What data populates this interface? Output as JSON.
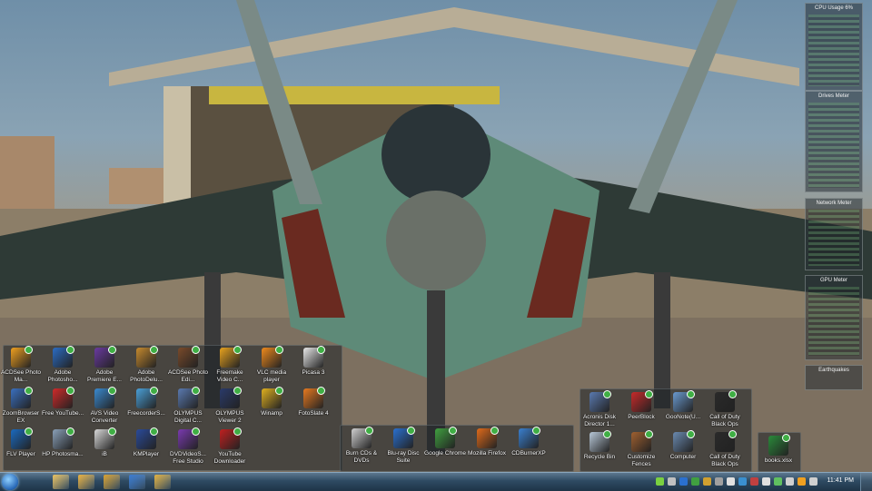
{
  "gadgets": {
    "cpu_title": "CPU Usage",
    "cpu_value": "6%",
    "drives_title": "Drives Meter",
    "network_title": "Network Meter",
    "gpu_title": "GPU Meter",
    "quakes_title": "Earthquakes"
  },
  "fence_left": {
    "icons": [
      {
        "label": "ACDSee Photo Ma...",
        "icon": "acdsee-icon",
        "color": "#f0a020"
      },
      {
        "label": "Adobe Photosho...",
        "icon": "photoshop-elements-icon",
        "color": "#2b6cc4"
      },
      {
        "label": "Adobe Premiere E...",
        "icon": "premiere-elements-icon",
        "color": "#6a3aa0"
      },
      {
        "label": "Adobe PhotoDelu...",
        "icon": "photodeluxe-icon",
        "color": "#c68a2e"
      },
      {
        "label": "ACDSee Photo Edi...",
        "icon": "acdsee-editor-icon",
        "color": "#7a4a2a"
      },
      {
        "label": "Freemake Video C...",
        "icon": "freemake-icon",
        "color": "#e8a21e"
      },
      {
        "label": "VLC media player",
        "icon": "vlc-icon",
        "color": "#f08a1c"
      },
      {
        "label": "Picasa 3",
        "icon": "picasa-icon",
        "color": "#e8e8e8"
      },
      {
        "label": "ZoomBrowser EX",
        "icon": "zoombrowser-icon",
        "color": "#3a70c0"
      },
      {
        "label": "Free YouTube...",
        "icon": "youtube-download-icon",
        "color": "#d02a2a"
      },
      {
        "label": "AVS Video Converter",
        "icon": "avs-icon",
        "color": "#3a8ad0"
      },
      {
        "label": "FreecorderS...",
        "icon": "freecorder-icon",
        "color": "#4aa0d8"
      },
      {
        "label": "OLYMPUS Digital C...",
        "icon": "olympus-icon",
        "color": "#5a7ab0"
      },
      {
        "label": "OLYMPUS Viewer 2",
        "icon": "olympus-viewer-icon",
        "color": "#2a3a6a"
      },
      {
        "label": "Winamp",
        "icon": "winamp-icon",
        "color": "#e0b020"
      },
      {
        "label": "FotoSlate 4",
        "icon": "fotoslate-icon",
        "color": "#e87a20"
      },
      {
        "label": "FLV Player",
        "icon": "flv-icon",
        "color": "#1a6ac0"
      },
      {
        "label": "HP Photosma...",
        "icon": "hp-photosmart-icon",
        "color": "#8aa0b8"
      },
      {
        "label": "iB",
        "icon": "ib-icon",
        "color": "#d8d8d8"
      },
      {
        "label": "KMPlayer",
        "icon": "kmplayer-icon",
        "color": "#2a4a9a"
      },
      {
        "label": "DVDVideoS... Free Studio",
        "icon": "dvdvideosoft-icon",
        "color": "#7a3ab0"
      },
      {
        "label": "YouTube Downloader",
        "icon": "youtube-downloader-icon",
        "color": "#c02020"
      }
    ]
  },
  "fence_middle": {
    "icons": [
      {
        "label": "Burn CDs & DVDs",
        "icon": "burn-disc-icon",
        "color": "#d0d0d0"
      },
      {
        "label": "Blu-ray Disc Suite",
        "icon": "bluray-icon",
        "color": "#2a70d0"
      },
      {
        "label": "Google Chrome",
        "icon": "chrome-icon",
        "color": "#40a040"
      },
      {
        "label": "Mozilla Firefox",
        "icon": "firefox-icon",
        "color": "#e06a1a"
      },
      {
        "label": "CDBurnerXP",
        "icon": "cdburnerxp-icon",
        "color": "#3a80d0"
      }
    ]
  },
  "fence_right": {
    "icons": [
      {
        "label": "Acronis Disk Director 1...",
        "icon": "acronis-icon",
        "color": "#5a7ab0"
      },
      {
        "label": "PeerBlock",
        "icon": "peerblock-icon",
        "color": "#c82a2a"
      },
      {
        "label": "GooNote(U...",
        "icon": "goonote-icon",
        "color": "#6a9ad0"
      },
      {
        "label": "Call of Duty Black Ops",
        "icon": "cod-icon",
        "color": "#2a2a2a"
      },
      {
        "label": "Recycle Bin",
        "icon": "recycle-bin-icon",
        "color": "#b8c8d8"
      },
      {
        "label": "Customize Fences",
        "icon": "fences-icon",
        "color": "#a06030"
      },
      {
        "label": "Computer",
        "icon": "computer-icon",
        "color": "#6a8ab0"
      },
      {
        "label": "Call of Duty Black Ops",
        "icon": "cod-mp-icon",
        "color": "#2a2a2a"
      }
    ]
  },
  "fence_far_right": {
    "icons": [
      {
        "label": "books.xlsx",
        "icon": "excel-file-icon",
        "color": "#2a8a3a"
      }
    ]
  },
  "taskbar": {
    "pinned": [
      {
        "icon": "explorer-icon",
        "color": "#e8c060"
      },
      {
        "icon": "folder-icon",
        "color": "#e8b040"
      },
      {
        "icon": "folder-icon",
        "color": "#d8a030"
      },
      {
        "icon": "media-player-icon",
        "color": "#3a7ad0"
      },
      {
        "icon": "folder-icon",
        "color": "#e0b040"
      }
    ],
    "tray": [
      {
        "icon": "tray-icon-1",
        "color": "#7ad040"
      },
      {
        "icon": "tray-icon-2",
        "color": "#c0c0c0"
      },
      {
        "icon": "tray-icon-3",
        "color": "#2a70d0"
      },
      {
        "icon": "tray-icon-4",
        "color": "#40a040"
      },
      {
        "icon": "tray-icon-5",
        "color": "#d0a030"
      },
      {
        "icon": "tray-icon-6",
        "color": "#a0a0a0"
      },
      {
        "icon": "tray-icon-7",
        "color": "#e0e0e0"
      },
      {
        "icon": "tray-icon-8",
        "color": "#3a90d0"
      },
      {
        "icon": "tray-icon-9",
        "color": "#c04040"
      },
      {
        "icon": "tray-icon-10",
        "color": "#e0e0e0"
      },
      {
        "icon": "tray-icon-11",
        "color": "#60c060"
      },
      {
        "icon": "tray-icon-12",
        "color": "#d0d0d0"
      },
      {
        "icon": "tray-icon-13",
        "color": "#f0a020"
      },
      {
        "icon": "tray-icon-14",
        "color": "#d0d0d0"
      }
    ],
    "clock": "11:41 PM"
  }
}
